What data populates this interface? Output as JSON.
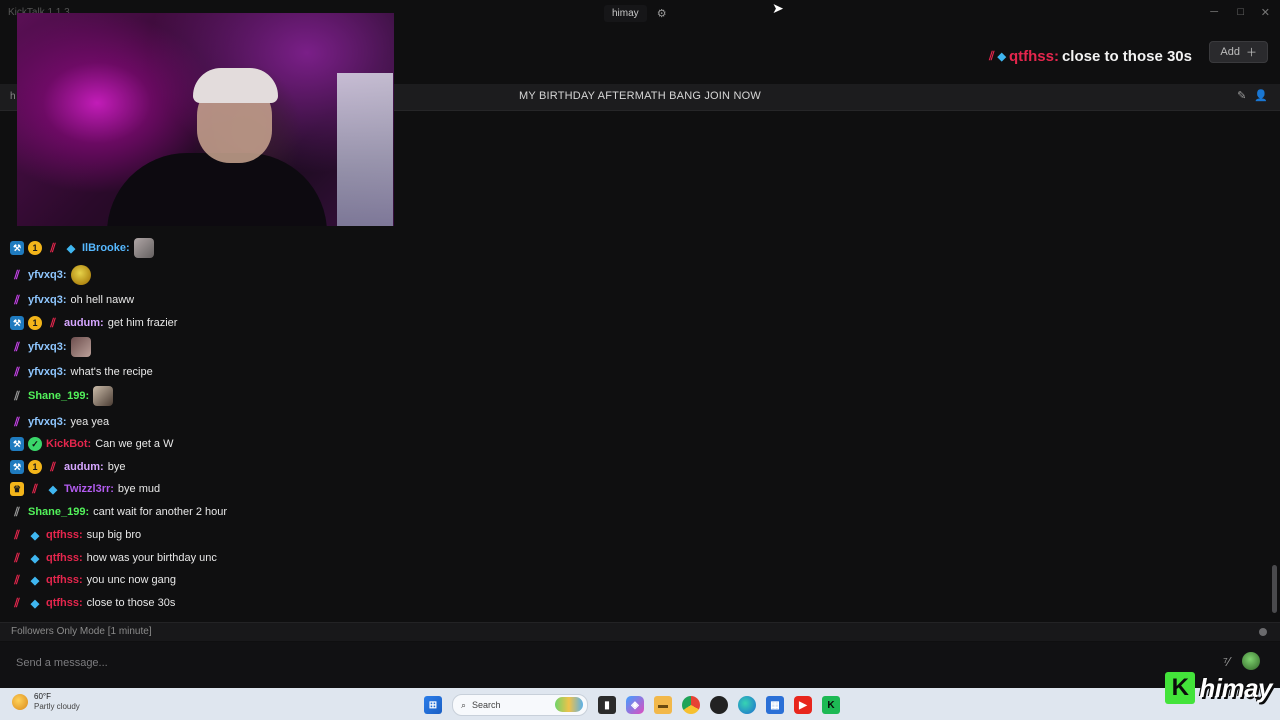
{
  "app": {
    "title": "KickTalk 1.1.3",
    "tab_label": "himay",
    "window_controls": {
      "minimize": "─",
      "maximize": "□",
      "close": "✕"
    }
  },
  "header": {
    "pinned_user": "qtfhss:",
    "pinned_text": "close to those 30s",
    "add_label": "Add",
    "add_icon": "plus-icon"
  },
  "stream": {
    "left_label": "h",
    "title": "MY BIRTHDAY AFTERMATH BANG JOIN NOW"
  },
  "chat": {
    "messages": [
      {
        "user": "IlBrooke:",
        "color": "#56b8ff",
        "badges": [
          "mod",
          "sub-1",
          "gift",
          "gem"
        ],
        "text": "",
        "emote": "brooke-photo-emote"
      },
      {
        "user": "yfvxq3:",
        "color": "#8fc7ff",
        "badges": [
          "sword-purple"
        ],
        "text": "",
        "emote": "pepe-emote"
      },
      {
        "user": "yfvxq3:",
        "color": "#8fc7ff",
        "badges": [
          "sword-purple"
        ],
        "text": "oh hell naww"
      },
      {
        "user": "audum:",
        "color": "#d6a6ff",
        "badges": [
          "mod",
          "sub-1",
          "gift"
        ],
        "text": "get him frazier"
      },
      {
        "user": "yfvxq3:",
        "color": "#8fc7ff",
        "badges": [
          "sword-purple"
        ],
        "text": "",
        "emote": "photo-emote"
      },
      {
        "user": "yfvxq3:",
        "color": "#8fc7ff",
        "badges": [
          "sword-purple"
        ],
        "text": "what's the recipe"
      },
      {
        "user": "Shane_199:",
        "color": "#52f25a",
        "badges": [
          "sword-grey"
        ],
        "text": "",
        "emote": "dog-emote"
      },
      {
        "user": "yfvxq3:",
        "color": "#8fc7ff",
        "badges": [
          "sword-purple"
        ],
        "text": "yea yea"
      },
      {
        "user": "KickBot:",
        "color": "#e5264d",
        "badges": [
          "mod",
          "verified"
        ],
        "text": "Can we get a W"
      },
      {
        "user": "audum:",
        "color": "#d6a6ff",
        "badges": [
          "mod",
          "sub-1",
          "gift"
        ],
        "text": "bye"
      },
      {
        "user": "Twizzl3rr:",
        "color": "#b35cf0",
        "badges": [
          "og-crown",
          "gift",
          "gem"
        ],
        "text": "bye mud"
      },
      {
        "user": "Shane_199:",
        "color": "#52f25a",
        "badges": [
          "sword-grey"
        ],
        "text": "cant wait for another 2 hour"
      },
      {
        "user": "qtfhss:",
        "color": "#e5264d",
        "badges": [
          "gift",
          "gem"
        ],
        "text": "sup big bro"
      },
      {
        "user": "qtfhss:",
        "color": "#e5264d",
        "badges": [
          "gift",
          "gem"
        ],
        "text": "how was your birthday unc"
      },
      {
        "user": "qtfhss:",
        "color": "#e5264d",
        "badges": [
          "gift",
          "gem"
        ],
        "text": "you unc now gang"
      },
      {
        "user": "qtfhss:",
        "color": "#e5264d",
        "badges": [
          "gift",
          "gem"
        ],
        "text": "close to those 30s"
      }
    ]
  },
  "status": {
    "followers_mode": "Followers Only Mode [1 minute]"
  },
  "composer": {
    "placeholder": "Send a message..."
  },
  "taskbar": {
    "temperature": "60°F",
    "condition": "Partly cloudy",
    "search_label": "Search"
  },
  "branding": {
    "logo_letter": "K",
    "name": "himay"
  }
}
